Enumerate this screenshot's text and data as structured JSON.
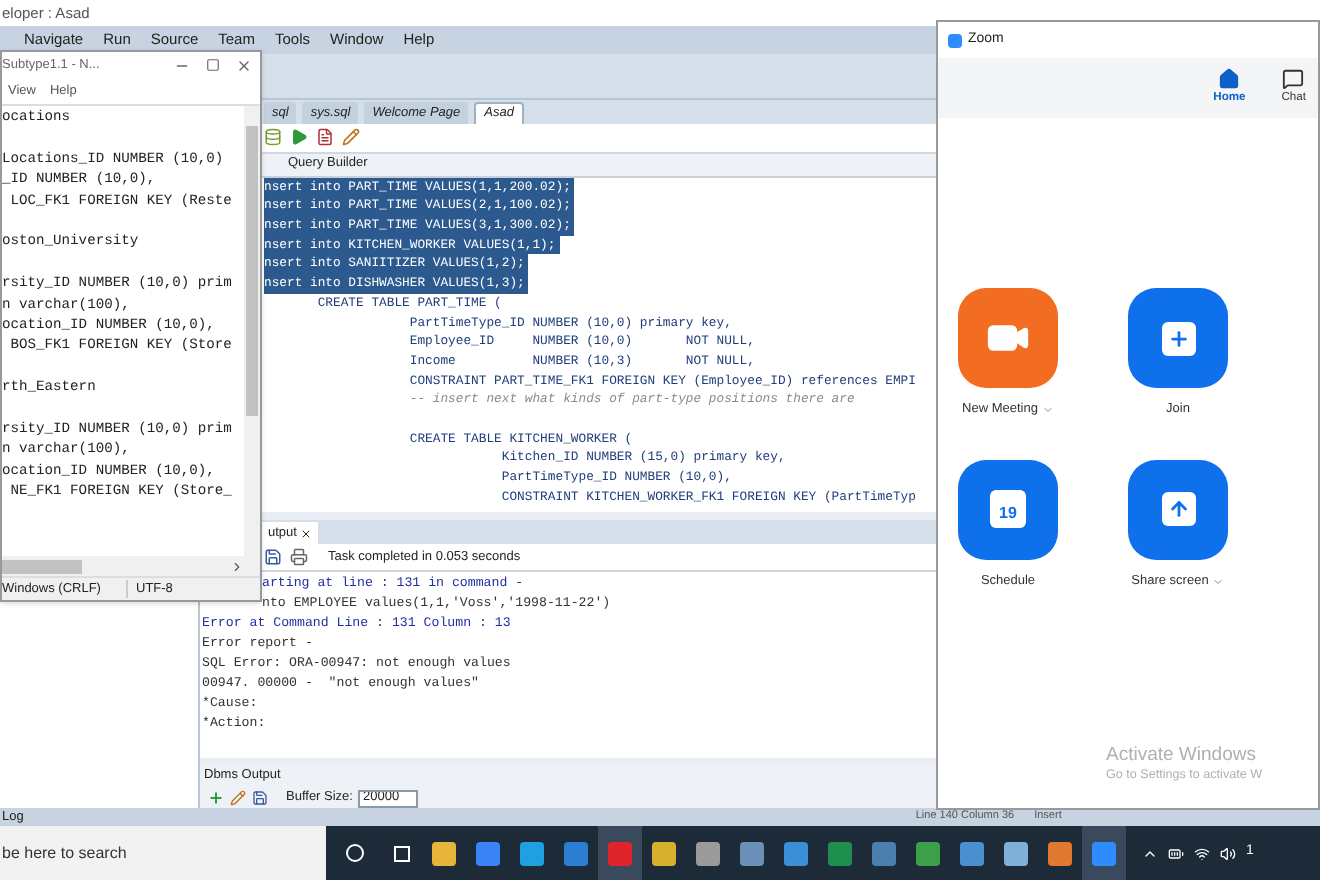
{
  "ide": {
    "title": "eloper : Asad",
    "menu": [
      "Navigate",
      "Run",
      "Source",
      "Team",
      "Tools",
      "Window",
      "Help"
    ],
    "doc_tabs": [
      {
        "label": "sql",
        "selected": false
      },
      {
        "label": "sys.sql",
        "selected": false
      },
      {
        "label": "Welcome Page",
        "selected": false
      },
      {
        "label": "Asad",
        "selected": true
      }
    ],
    "subtab": "Query Builder",
    "code_blocks": [
      [
        {
          "text": "nsert into PART_TIME VALUES(1,1,200.02);",
          "kind": "code",
          "selected": true
        },
        {
          "text": "nsert into PART_TIME VALUES(2,1,100.02);",
          "kind": "code",
          "selected": true
        },
        {
          "text": "nsert into PART_TIME VALUES(3,1,300.02);",
          "kind": "code",
          "selected": true
        },
        {
          "text": "nsert into KITCHEN_WORKER VALUES(1,1);",
          "kind": "code",
          "selected": true
        },
        {
          "text": "nsert into SANIITIZER VALUES(1,2);",
          "kind": "code",
          "selected": true
        },
        {
          "text": "nsert into DISHWASHER VALUES(1,3);",
          "kind": "code",
          "selected": true
        },
        {
          "text": "       CREATE TABLE PART_TIME (",
          "kind": "code",
          "selected": false
        },
        {
          "text": "                   PartTimeType_ID NUMBER (10,0) primary key,",
          "kind": "code",
          "selected": false
        },
        {
          "text": "                   Employee_ID     NUMBER (10,0)       NOT NULL,",
          "kind": "code",
          "selected": false
        },
        {
          "text": "                   Income          NUMBER (10,3)       NOT NULL,",
          "kind": "code",
          "selected": false
        },
        {
          "text": "                   CONSTRAINT PART_TIME_FK1 FOREIGN KEY (Employee_ID) references EMPI",
          "kind": "code",
          "selected": false
        },
        {
          "text": "                   -- insert next what kinds of part-type positions there are",
          "kind": "comment",
          "selected": false
        }
      ],
      [
        {
          "text": "                   CREATE TABLE KITCHEN_WORKER (",
          "kind": "code",
          "selected": false
        },
        {
          "text": "                               Kitchen_ID NUMBER (15,0) primary key,",
          "kind": "code",
          "selected": false
        },
        {
          "text": "                               PartTimeType_ID NUMBER (10,0),",
          "kind": "code",
          "selected": false
        },
        {
          "text": "                               CONSTRAINT KITCHEN_WORKER_FK1 FOREIGN KEY (PartTimeTyp",
          "kind": "code",
          "selected": false
        }
      ]
    ],
    "output": {
      "tab": "utput",
      "status": "Task completed in 0.053 seconds",
      "lines_beside_notepad": [
        {
          "text": "arting at line : 131 in command -",
          "kind": "message"
        },
        {
          "text": "nto EMPLOYEE values(1,1,'Voss','1998-11-22')",
          "kind": "plain"
        }
      ],
      "lines": [
        {
          "text": "Error at Command Line : 131 Column : 13",
          "kind": "message"
        },
        {
          "text": "Error report -",
          "kind": "plain"
        },
        {
          "text": "SQL Error: ORA-00947: not enough values",
          "kind": "plain"
        },
        {
          "text": "00947. 00000 -  \"not enough values\"",
          "kind": "plain"
        },
        {
          "text": "*Cause:",
          "kind": "plain"
        },
        {
          "text": "*Action:",
          "kind": "plain"
        }
      ]
    },
    "dbms_output": {
      "title": "Dbms Output",
      "buffer_label": "Buffer Size:",
      "buffer_value": "20000"
    },
    "log_tab": "Log",
    "status_bar": [
      "Line 140 Column 36",
      "Insert"
    ]
  },
  "notepad": {
    "title": "Subtype1.1 - N...",
    "menu": [
      "View",
      "Help"
    ],
    "blocks": [
      [
        "ocations"
      ],
      [
        "Locations_ID NUMBER (10,0)",
        "_ID NUMBER (10,0),",
        " LOC_FK1 FOREIGN KEY (Reste"
      ],
      [
        "oston_University"
      ],
      [
        "rsity_ID NUMBER (10,0) prim",
        "n varchar(100),",
        "ocation_ID NUMBER (10,0),",
        " BOS_FK1 FOREIGN KEY (Store"
      ],
      [
        "rth_Eastern"
      ],
      [
        "rsity_ID NUMBER (10,0) prim",
        "n varchar(100),",
        "ocation_ID NUMBER (10,0),",
        " NE_FK1 FOREIGN KEY (Store_"
      ]
    ],
    "status": [
      "Windows (CRLF)",
      "UTF-8"
    ]
  },
  "zoom": {
    "title": "Zoom",
    "nav": [
      {
        "label": "Home",
        "kind": "home",
        "selected": true
      },
      {
        "label": "Chat",
        "kind": "chat",
        "selected": false
      }
    ],
    "actions": [
      {
        "label": "New Meeting",
        "kind": "video",
        "color": "#f26d21",
        "dropdown": true
      },
      {
        "label": "Join",
        "kind": "plus",
        "color": "#0e71eb",
        "dropdown": false
      },
      {
        "label": "Schedule",
        "kind": "calendar",
        "color": "#0e71eb",
        "dropdown": false,
        "day": "19"
      },
      {
        "label": "Share screen",
        "kind": "share",
        "color": "#0e71eb",
        "dropdown": true
      }
    ]
  },
  "activation_notice": {
    "title": "Activate Windows",
    "text": "Go to Settings to activate W"
  },
  "taskbar": {
    "search_placeholder": "be here to search",
    "clock": "1",
    "apps": [
      {
        "color": "#e8b43a",
        "active": false
      },
      {
        "color": "#3b82f6",
        "active": false
      },
      {
        "color": "#1fa0e0",
        "active": false
      },
      {
        "color": "#2a7fd4",
        "active": false
      },
      {
        "color": "#e0242b",
        "active": true
      },
      {
        "color": "#d8b030",
        "active": false
      },
      {
        "color": "#9a9a9a",
        "active": false
      },
      {
        "color": "#6c8fb8",
        "active": false
      },
      {
        "color": "#3a8fd8",
        "active": false
      },
      {
        "color": "#1f8f4e",
        "active": false
      },
      {
        "color": "#4a7fb0",
        "active": false
      },
      {
        "color": "#3ca04a",
        "active": false
      },
      {
        "color": "#4a90d0",
        "active": false
      },
      {
        "color": "#7fb0d8",
        "active": false
      },
      {
        "color": "#e07830",
        "active": false
      },
      {
        "color": "#2d8cff",
        "active": true
      }
    ]
  }
}
